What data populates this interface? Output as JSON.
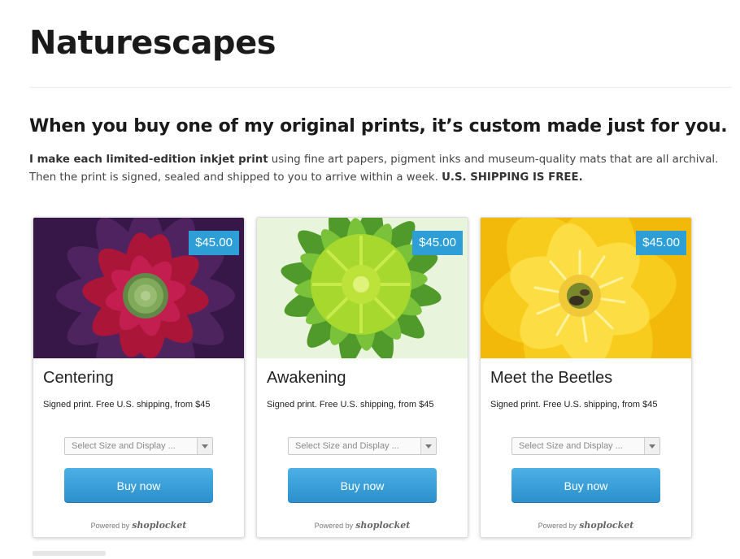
{
  "site": {
    "title": "Naturescapes"
  },
  "headline": "When you buy one of my original prints, it’s custom made just for you.",
  "intro": {
    "bold_lead": "I make each limited-edition inkjet print",
    "text": " using fine art papers, pigment inks and museum-quality mats that are all archival. Then the print is signed, sealed and shipped to you to arrive within a week. ",
    "bold_tail": "U.S. SHIPPING IS FREE."
  },
  "colors": {
    "accent": "#2e9fd6",
    "button_top": "#4db0e6",
    "button_bottom": "#2a8fcb"
  },
  "products": [
    {
      "title": "Centering",
      "price": "$45.00",
      "description": "Signed print. Free U.S. shipping, from $45",
      "select_placeholder": "Select Size and Display ...",
      "button_label": "Buy now",
      "powered_label": "Powered by",
      "powered_brand": "shoplocket",
      "image": "red-succulent-rosette"
    },
    {
      "title": "Awakening",
      "price": "$45.00",
      "description": "Signed print. Free U.S. shipping, from $45",
      "select_placeholder": "Select Size and Display ...",
      "button_label": "Buy now",
      "powered_label": "Powered by",
      "powered_brand": "shoplocket",
      "image": "green-sunflower-bud"
    },
    {
      "title": "Meet the Beetles",
      "price": "$45.00",
      "description": "Signed print. Free U.S. shipping, from $45",
      "select_placeholder": "Select Size and Display ...",
      "button_label": "Buy now",
      "powered_label": "Powered by",
      "powered_brand": "shoplocket",
      "image": "yellow-cactus-flower"
    }
  ]
}
